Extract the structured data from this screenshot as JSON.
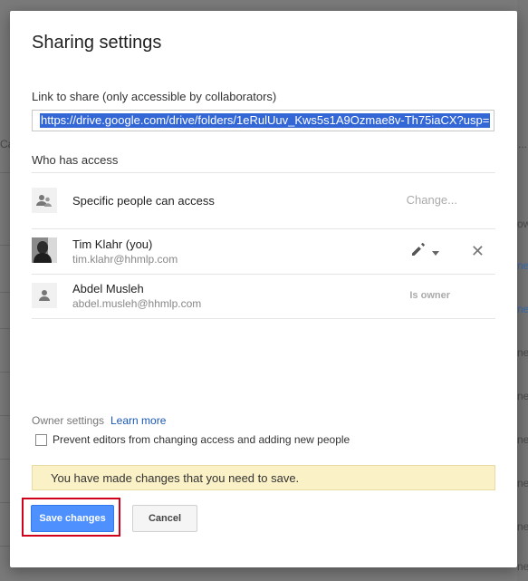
{
  "background": {
    "left_fragment": "Ca",
    "right_fragments": [
      "...",
      "ow",
      "ne",
      "ne",
      "ne",
      "ne",
      "ne",
      "ne",
      "ne",
      "ne"
    ]
  },
  "dialog": {
    "title": "Sharing settings",
    "link_label": "Link to share (only accessible by collaborators)",
    "link_value": "https://drive.google.com/drive/folders/1eRulUuv_Kws5s1A9Ozmae8v-Th75iaCX?usp=",
    "who_has_access": "Who has access",
    "access_mode": {
      "label": "Specific people can access",
      "change": "Change...",
      "icon": "people-icon"
    },
    "people": [
      {
        "name": "Tim Klahr (you)",
        "email": "tim.klahr@hhmlp.com",
        "avatar": "photo",
        "permission_icon": "pencil-icon",
        "remove_icon": "close-icon"
      },
      {
        "name": "Abdel Musleh",
        "email": "abdel.musleh@hhmlp.com",
        "avatar": "person-icon",
        "role": "Is owner"
      }
    ],
    "owner_settings": {
      "label": "Owner settings",
      "learn_more": "Learn more"
    },
    "prevent_editors": {
      "checked": false,
      "label": "Prevent editors from changing access and adding new people"
    },
    "notice": "You have made changes that you need to save.",
    "buttons": {
      "save": "Save changes",
      "cancel": "Cancel"
    }
  },
  "colors": {
    "primary_button": "#4d90fe",
    "notice_bg": "#fbf1c6",
    "highlight": "#d0021b",
    "link": "#1a57b8"
  }
}
